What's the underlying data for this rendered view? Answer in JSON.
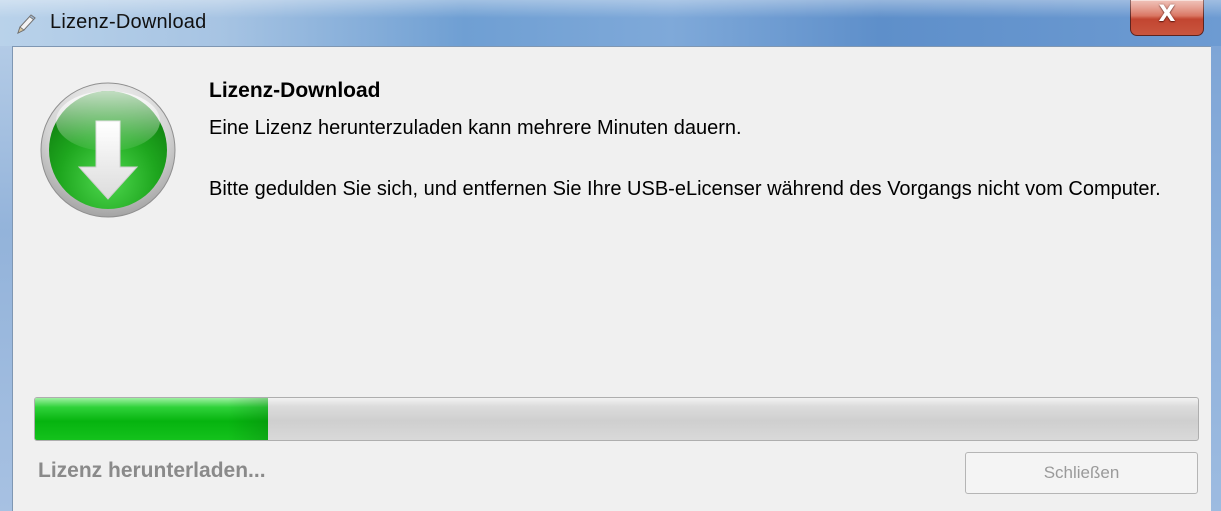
{
  "window": {
    "title": "Lizenz-Download",
    "close_glyph": "X"
  },
  "content": {
    "heading": "Lizenz-Download",
    "message_line1": "Eine Lizenz herunterzuladen kann mehrere Minuten dauern.",
    "message_line2": "Bitte gedulden Sie sich, und entfernen Sie Ihre USB-eLicenser während des Vorgangs nicht vom Computer."
  },
  "progress": {
    "fraction": 0.2
  },
  "footer": {
    "status_text": "Lizenz herunterladen...",
    "close_button_label": "Schließen",
    "close_button_enabled": false
  },
  "icons": {
    "app": "pen-icon",
    "main": "download-arrow-icon"
  },
  "colors": {
    "progress_green": "#06b40f",
    "icon_green": "#1a9e1a",
    "status_gray": "#8a8a8a",
    "close_red": "#c24631"
  }
}
